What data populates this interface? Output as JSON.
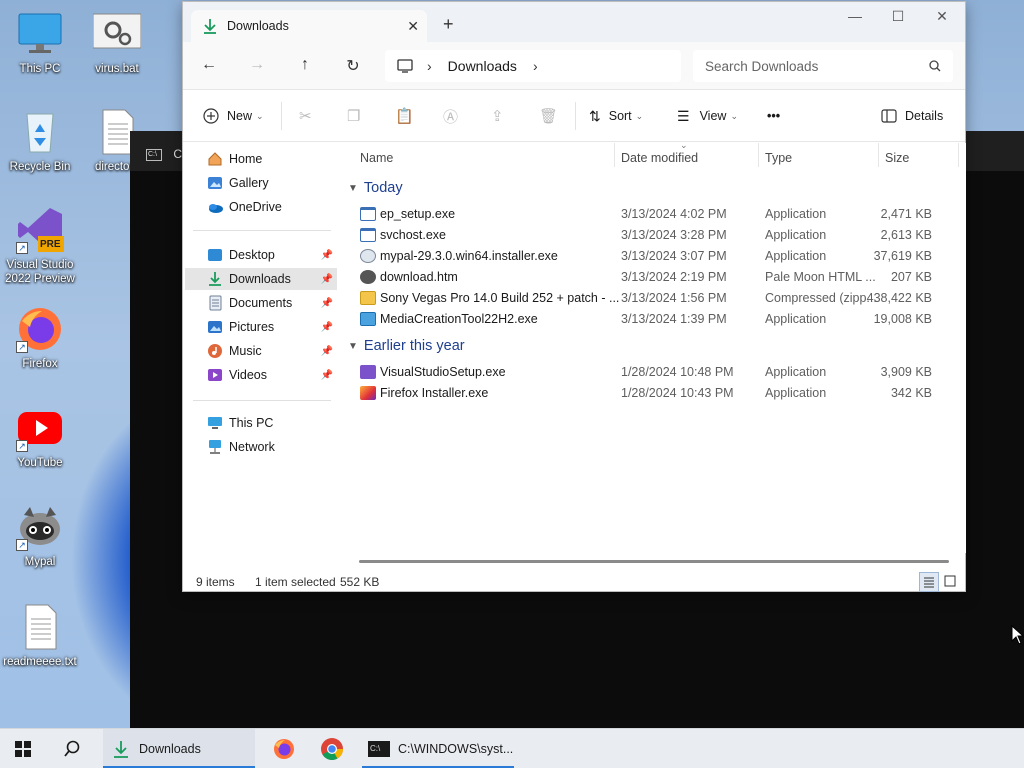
{
  "desktop": {
    "icons": [
      {
        "label": "This PC",
        "icon": "monitor-icon"
      },
      {
        "label": "virus.bat",
        "icon": "batch-file-icon"
      },
      {
        "label": "Recycle Bin",
        "icon": "recycle-bin-icon"
      },
      {
        "label": "directory",
        "icon": "text-file-icon"
      },
      {
        "label": "Visual Studio 2022 Preview",
        "icon": "visual-studio-icon",
        "badge": "PRE"
      },
      {
        "label": "Firefox",
        "icon": "firefox-icon"
      },
      {
        "label": "YouTube",
        "icon": "youtube-icon"
      },
      {
        "label": "Mypal",
        "icon": "mypal-raccoon-icon"
      },
      {
        "label": "readmeeee.txt",
        "icon": "text-file-icon"
      }
    ]
  },
  "console": {
    "title": "C:"
  },
  "explorer": {
    "tab_title": "Downloads",
    "address": {
      "location": "Downloads"
    },
    "search": {
      "placeholder": "Search Downloads"
    },
    "toolbar": {
      "new_label": "New",
      "sort_label": "Sort",
      "view_label": "View",
      "more_label": "•••",
      "details_label": "Details"
    },
    "nav": {
      "top": [
        {
          "label": "Home",
          "icon": "home-icon"
        },
        {
          "label": "Gallery",
          "icon": "gallery-icon"
        },
        {
          "label": "OneDrive",
          "icon": "onedrive-icon"
        }
      ],
      "pinned": [
        {
          "label": "Desktop",
          "icon": "desktop-folder-icon"
        },
        {
          "label": "Downloads",
          "icon": "downloads-folder-icon",
          "selected": true
        },
        {
          "label": "Documents",
          "icon": "documents-folder-icon"
        },
        {
          "label": "Pictures",
          "icon": "pictures-folder-icon"
        },
        {
          "label": "Music",
          "icon": "music-folder-icon"
        },
        {
          "label": "Videos",
          "icon": "videos-folder-icon"
        }
      ],
      "bottom": [
        {
          "label": "This PC",
          "icon": "this-pc-icon"
        },
        {
          "label": "Network",
          "icon": "network-icon"
        }
      ]
    },
    "columns": {
      "name": "Name",
      "date": "Date modified",
      "type": "Type",
      "size": "Size"
    },
    "groups": [
      {
        "label": "Today",
        "files": [
          {
            "name": "ep_setup.exe",
            "date": "3/13/2024 4:02 PM",
            "type": "Application",
            "size": "2,471 KB",
            "icon": "exe-icon"
          },
          {
            "name": "svchost.exe",
            "date": "3/13/2024 3:28 PM",
            "type": "Application",
            "size": "2,613 KB",
            "icon": "exe-icon"
          },
          {
            "name": "mypal-29.3.0.win64.installer.exe",
            "date": "3/13/2024 3:07 PM",
            "type": "Application",
            "size": "37,619 KB",
            "icon": "installer-icon"
          },
          {
            "name": "download.htm",
            "date": "3/13/2024 2:19 PM",
            "type": "Pale Moon HTML ...",
            "size": "207 KB",
            "icon": "html-icon"
          },
          {
            "name": "Sony Vegas Pro 14.0 Build 252 + patch - ...",
            "date": "3/13/2024 1:56 PM",
            "type": "Compressed (zipp...",
            "size": "438,422 KB",
            "icon": "zip-folder-icon"
          },
          {
            "name": "MediaCreationTool22H2.exe",
            "date": "3/13/2024 1:39 PM",
            "type": "Application",
            "size": "19,008 KB",
            "icon": "media-creation-icon"
          }
        ]
      },
      {
        "label": "Earlier this year",
        "files": [
          {
            "name": "VisualStudioSetup.exe",
            "date": "1/28/2024 10:48 PM",
            "type": "Application",
            "size": "3,909 KB",
            "icon": "visual-studio-setup-icon"
          },
          {
            "name": "Firefox Installer.exe",
            "date": "1/28/2024 10:43 PM",
            "type": "Application",
            "size": "342 KB",
            "icon": "firefox-installer-icon"
          }
        ]
      }
    ],
    "status": {
      "items": "9 items",
      "selected": "1 item selected",
      "size": "552 KB"
    }
  },
  "taskbar": {
    "start_icon": "windows-logo-icon",
    "search_icon": "search-icon",
    "apps": [
      {
        "label": "Downloads",
        "icon": "file-explorer-downloads-icon",
        "active": true
      },
      {
        "label": "",
        "icon": "firefox-icon"
      },
      {
        "label": "",
        "icon": "chrome-icon"
      },
      {
        "label": "C:\\WINDOWS\\syst...",
        "icon": "command-prompt-icon"
      }
    ]
  },
  "colors": {
    "accent": "#2a7bd8",
    "group_heading": "#1f3f8f",
    "selection": "#e5e5e5"
  }
}
